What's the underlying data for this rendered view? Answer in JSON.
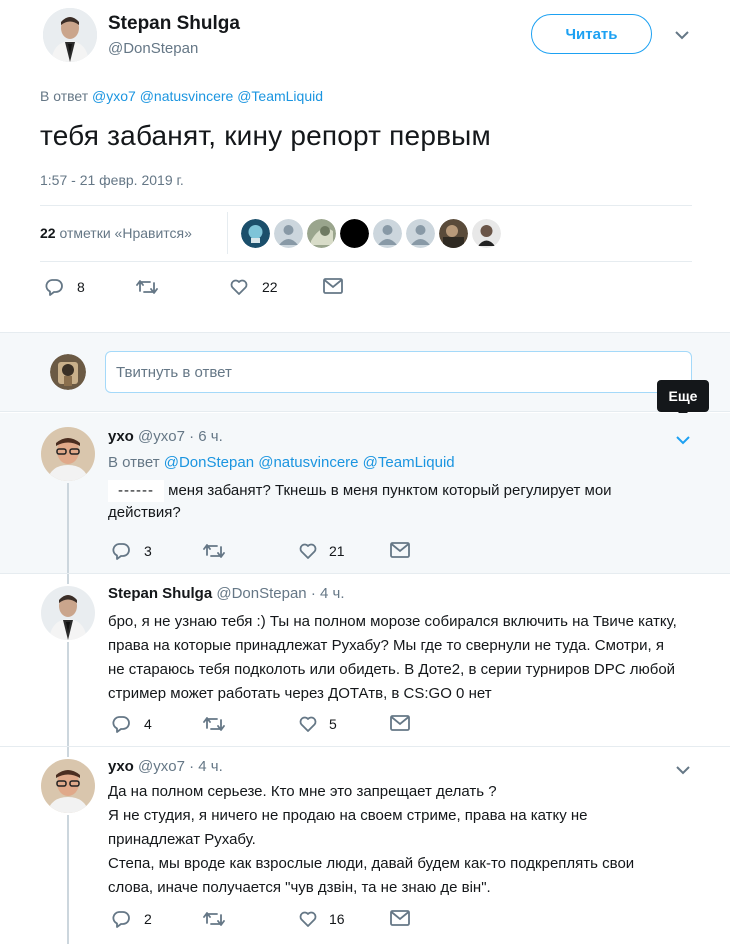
{
  "main_tweet": {
    "author_name": "Stepan Shulga",
    "author_handle": "@DonStepan",
    "follow_label": "Читать",
    "reply_prefix": "В ответ",
    "reply_mentions": [
      "@yxo7",
      "@natusvincere",
      "@TeamLiquid"
    ],
    "text": "тебя забанят, кину репорт первым",
    "timestamp": "1:57 - 21 февр. 2019 г.",
    "likes_count": "22",
    "likes_label": "отметки «Нравится»",
    "actions": {
      "replies": "8",
      "likes": "22"
    }
  },
  "reply_box": {
    "placeholder": "Твитнуть в ответ",
    "tooltip": "Еще"
  },
  "replies": [
    {
      "author_name": "yxo",
      "author_handle": "@yxo7",
      "time": "· 6 ч.",
      "reply_prefix": "В ответ",
      "reply_mentions": [
        "@DonStepan",
        "@natusvincere",
        "@TeamLiquid"
      ],
      "redacted": "------",
      "text": "меня забанят? Ткнешь в меня пунктом который регулирует мои действия?",
      "replies": "3",
      "likes": "21"
    },
    {
      "author_name": "Stepan Shulga",
      "author_handle": "@DonStepan",
      "time": "· 4 ч.",
      "text": "бро, я не узнаю тебя :) Ты на полном морозе собирался включить на Твиче катку, права на которые принадлежат Рухабу? Мы где то свернули не туда. Смотри, я не стараюсь тебя подколоть или обидеть. В Доте2, в серии турниров DPC любой стример может работать через ДОТАтв, в CS:GO 0 нет",
      "replies": "4",
      "likes": "5"
    },
    {
      "author_name": "yxo",
      "author_handle": "@yxo7",
      "time": "· 4 ч.",
      "text_lines": [
        "Да на полном серьезе. Кто мне это запрещает делать ?",
        "Я не студия, я ничего не продаю на своем стриме, права на катку не принадлежат Рухабу.",
        "Степа, мы вроде как взрослые люди, давай будем как-то подкреплять свои слова, иначе получается \"чув дзвін, та не знаю де він\"."
      ],
      "replies": "2",
      "likes": "16"
    }
  ],
  "colors": {
    "accent": "#1da1f2",
    "link": "#1b95e0",
    "muted": "#657786",
    "tooltip_bg": "#14171a",
    "reply_bg": "#f5f8fa"
  },
  "icons": [
    "reply-icon",
    "retweet-icon",
    "like-icon",
    "message-icon",
    "chevron-down-icon"
  ]
}
